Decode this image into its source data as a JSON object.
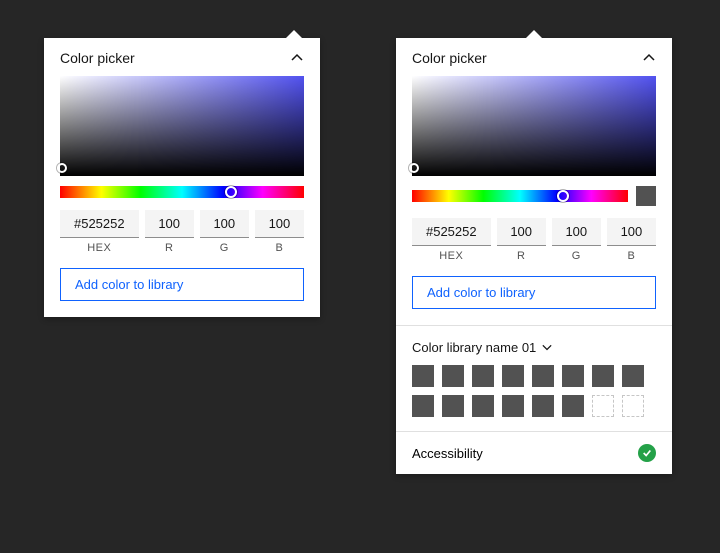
{
  "picker_title": "Color picker",
  "hex": {
    "value": "#525252",
    "label": "HEX"
  },
  "r": {
    "value": "100",
    "label": "R"
  },
  "g": {
    "value": "100",
    "label": "G"
  },
  "b": {
    "value": "100",
    "label": "B"
  },
  "add_button": "Add color to library",
  "library_name": "Color library name 01",
  "accessibility_label": "Accessibility",
  "hue_cursor_pct": 70,
  "swatch_color": "#525252",
  "library_swatch_count_filled": 14,
  "library_swatch_count_empty": 2
}
